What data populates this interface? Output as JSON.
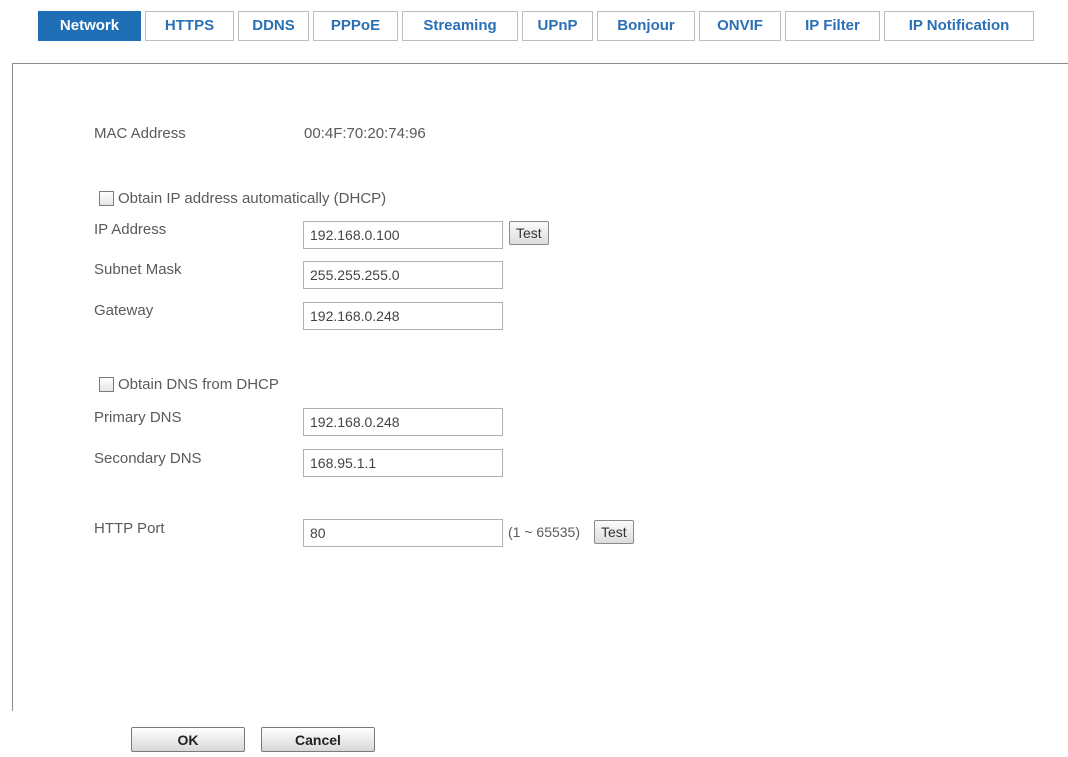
{
  "tabs": [
    {
      "label": "Network",
      "active": true
    },
    {
      "label": "HTTPS",
      "active": false
    },
    {
      "label": "DDNS",
      "active": false
    },
    {
      "label": "PPPoE",
      "active": false
    },
    {
      "label": "Streaming",
      "active": false
    },
    {
      "label": "UPnP",
      "active": false
    },
    {
      "label": "Bonjour",
      "active": false
    },
    {
      "label": "ONVIF",
      "active": false
    },
    {
      "label": "IP Filter",
      "active": false
    },
    {
      "label": "IP Notification",
      "active": false
    }
  ],
  "colors": {
    "active_tab": "#1e6fb5",
    "tab_text": "#2b6fb5"
  },
  "network": {
    "mac_label": "MAC Address",
    "mac_value": "00:4F:70:20:74:96",
    "dhcp_label": "Obtain IP address automatically (DHCP)",
    "dhcp_checked": false,
    "ip_label": "IP Address",
    "ip_value": "192.168.0.100",
    "ip_test_label": "Test",
    "subnet_label": "Subnet Mask",
    "subnet_value": "255.255.255.0",
    "gateway_label": "Gateway",
    "gateway_value": "192.168.0.248",
    "dns_dhcp_label": "Obtain DNS from DHCP",
    "dns_dhcp_checked": false,
    "primary_dns_label": "Primary DNS",
    "primary_dns_value": "192.168.0.248",
    "secondary_dns_label": "Secondary DNS",
    "secondary_dns_value": "168.95.1.1",
    "http_port_label": "HTTP Port",
    "http_port_value": "80",
    "http_port_range": "(1 ~ 65535)",
    "http_test_label": "Test"
  },
  "actions": {
    "ok_label": "OK",
    "cancel_label": "Cancel"
  }
}
